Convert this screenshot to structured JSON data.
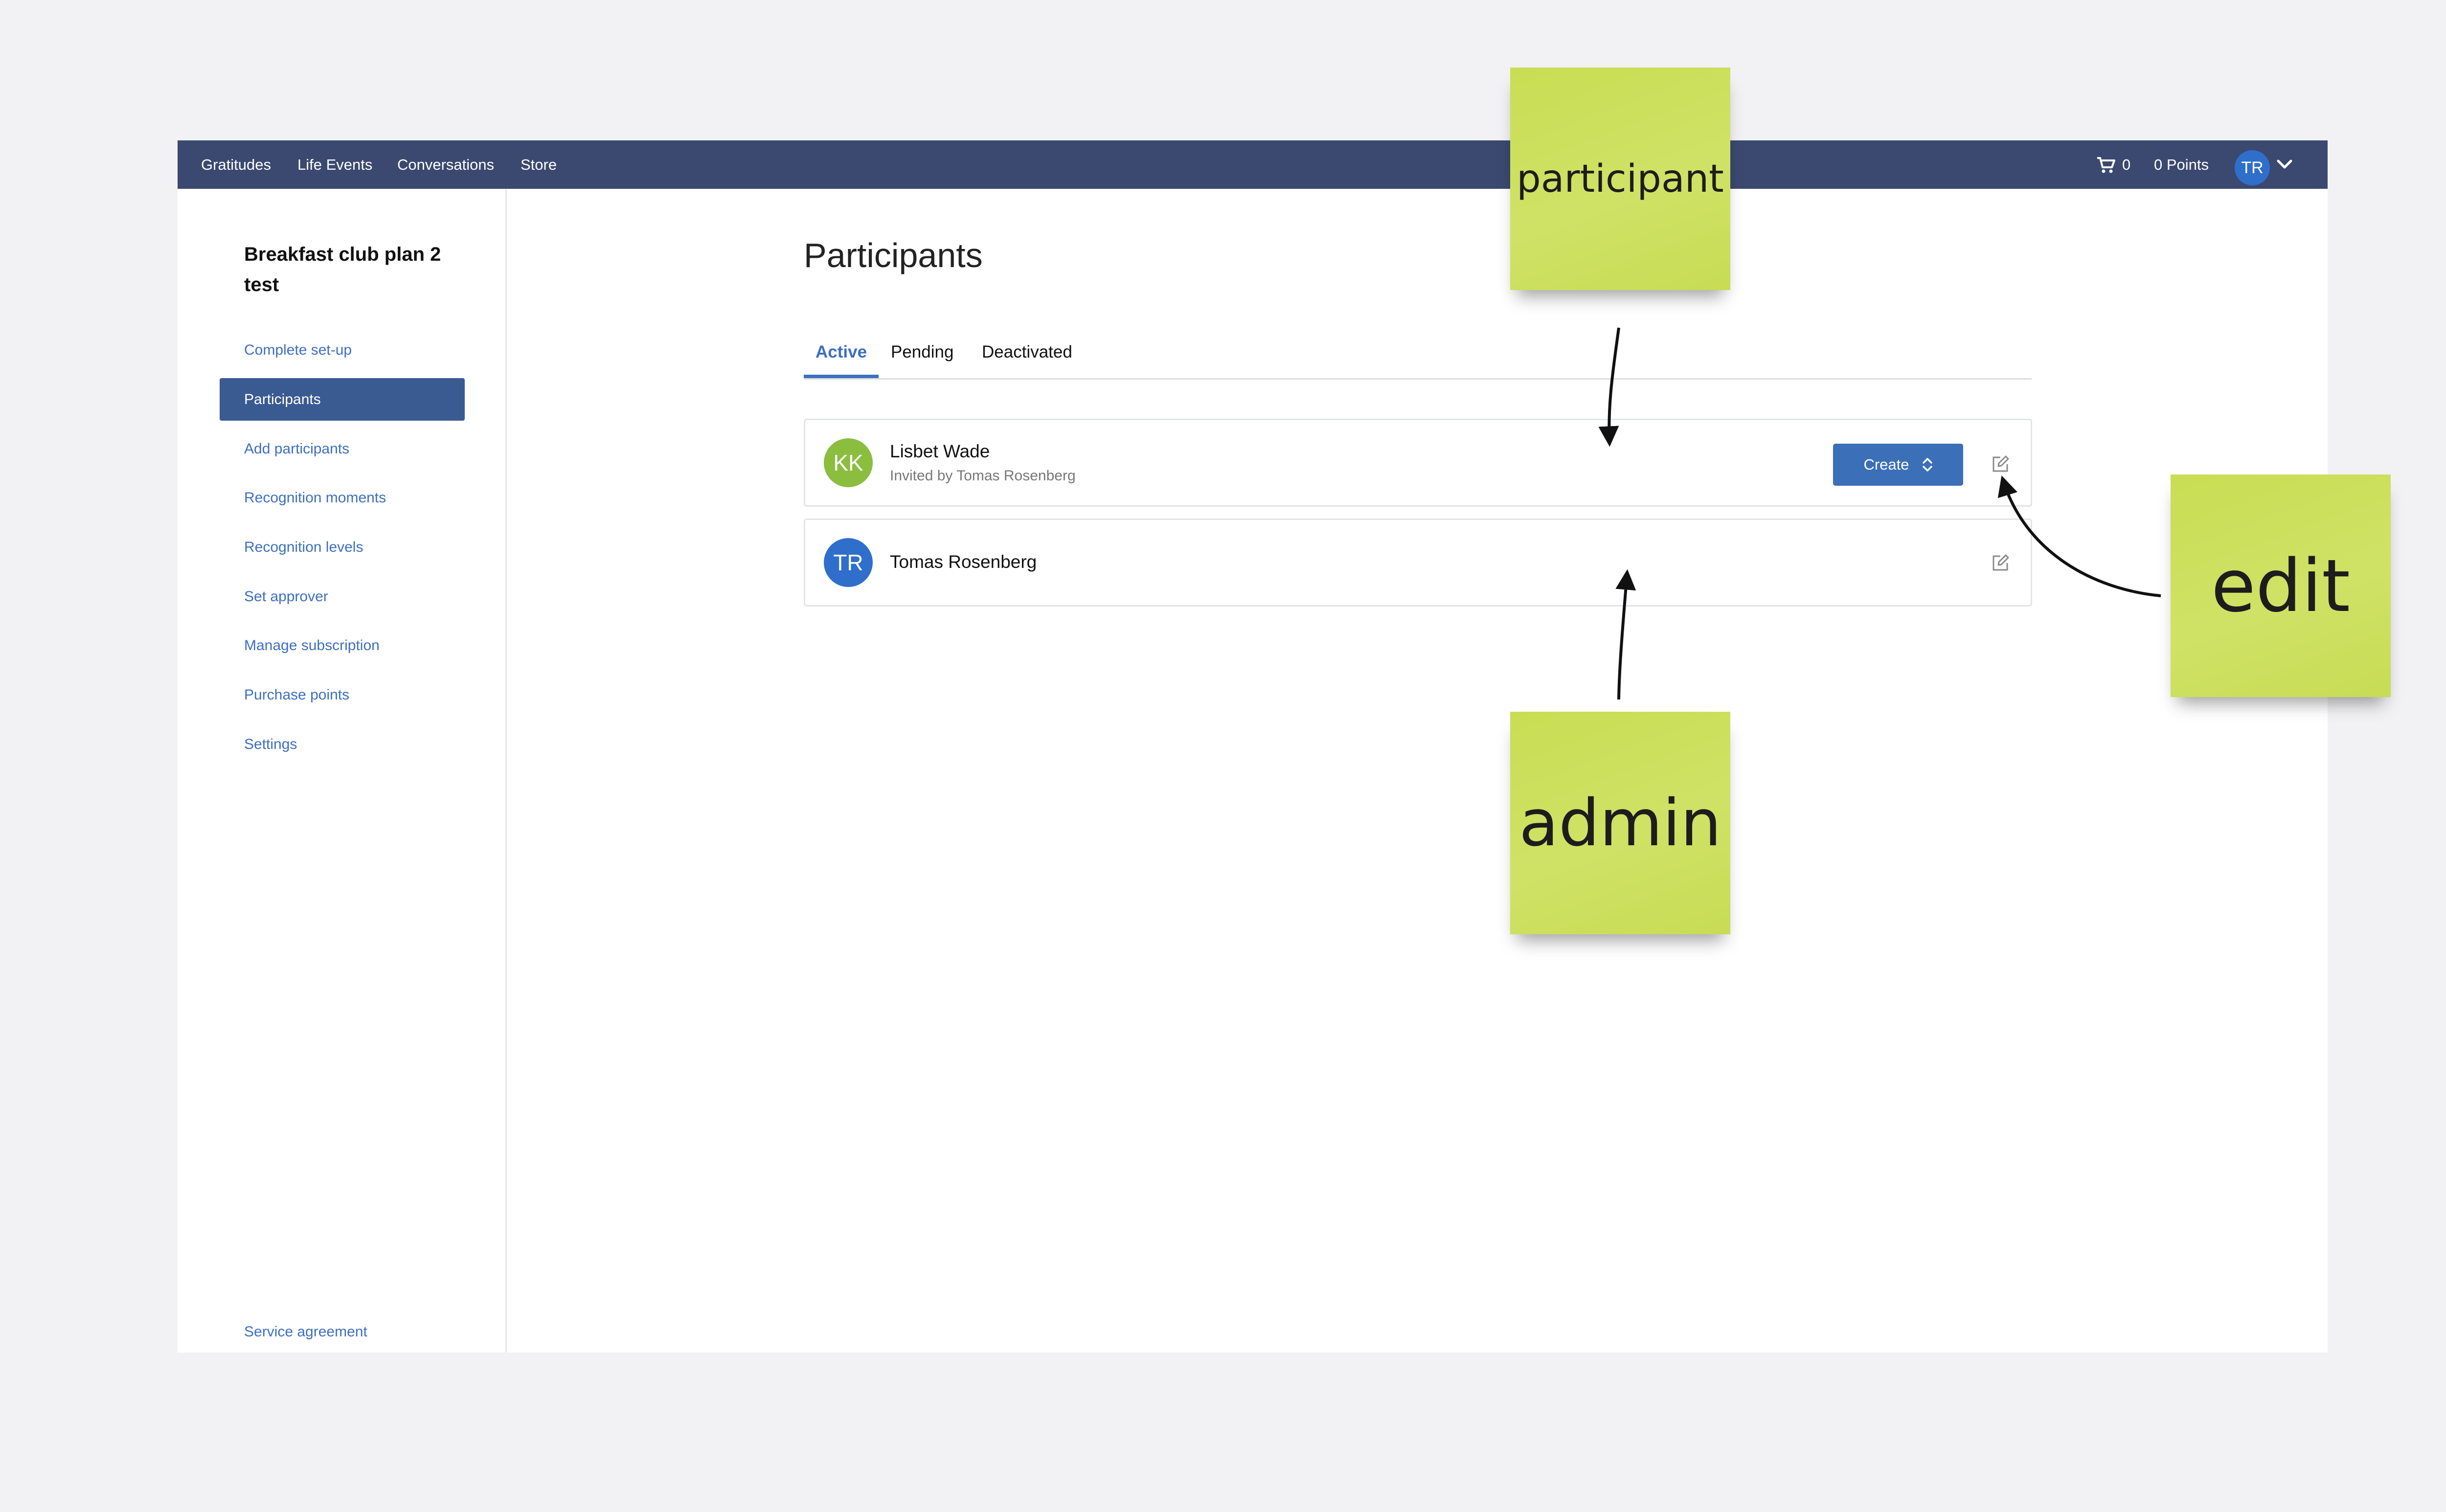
{
  "topbar": {
    "nav": [
      "Gratitudes",
      "Life Events",
      "Conversations",
      "Store"
    ],
    "cart_count": "0",
    "points": "0 Points",
    "user_initials": "TR"
  },
  "sidebar": {
    "plan_title": "Breakfast club plan 2 test",
    "items": [
      {
        "label": "Complete set-up",
        "active": false
      },
      {
        "label": "Participants",
        "active": true
      },
      {
        "label": "Add participants",
        "active": false
      },
      {
        "label": "Recognition moments",
        "active": false
      },
      {
        "label": "Recognition levels",
        "active": false
      },
      {
        "label": "Set approver",
        "active": false
      },
      {
        "label": "Manage subscription",
        "active": false
      },
      {
        "label": "Purchase points",
        "active": false
      },
      {
        "label": "Settings",
        "active": false
      }
    ],
    "footer_link": "Service agreement"
  },
  "main": {
    "title": "Participants",
    "tabs": [
      {
        "label": "Active",
        "active": true
      },
      {
        "label": "Pending",
        "active": false
      },
      {
        "label": "Deactivated",
        "active": false
      }
    ],
    "participants": [
      {
        "initials": "KK",
        "avatar_color": "#8bbd3f",
        "name": "Lisbet Wade",
        "subtitle": "Invited by Tomas Rosenberg",
        "action_label": "Create"
      },
      {
        "initials": "TR",
        "avatar_color": "#2f6fcb",
        "name": "Tomas Rosenberg",
        "subtitle": "",
        "action_label": ""
      }
    ]
  },
  "annotations": {
    "participant": "participant",
    "admin": "admin",
    "edit": "edit"
  },
  "colors": {
    "topbar": "#3b4970",
    "accent": "#3d6fc0",
    "sticky_note": "#cfe162"
  }
}
